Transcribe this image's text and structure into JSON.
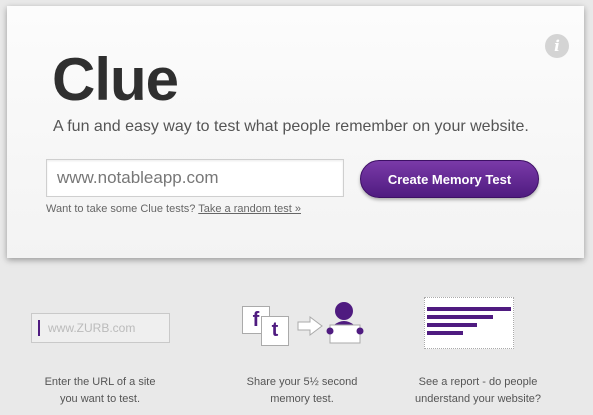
{
  "hero": {
    "title": "Clue",
    "tagline": "A fun and easy way to test what people remember on your website.",
    "info_icon": "info-icon",
    "url_input": {
      "value": "",
      "placeholder": "www.notableapp.com"
    },
    "create_button_label": "Create Memory Test",
    "hint_text": "Want to take some Clue tests?",
    "hint_link": "Take a random test »"
  },
  "colors": {
    "accent": "#4f1b80",
    "background": "#e9e9e9"
  },
  "steps": [
    {
      "placeholder": "www.ZURB.com",
      "caption": "Enter the URL of a site\nyou want to test.",
      "icon": "url-input-illustration"
    },
    {
      "facebook_glyph": "f",
      "twitter_glyph": "t",
      "caption": "Share your 5½ second\nmemory test.",
      "icon": "share-illustration"
    },
    {
      "caption": "See a report - do people\nunderstand your website?",
      "icon": "report-illustration",
      "bar_fractions": [
        1.0,
        0.75,
        0.55,
        0.4
      ]
    }
  ]
}
